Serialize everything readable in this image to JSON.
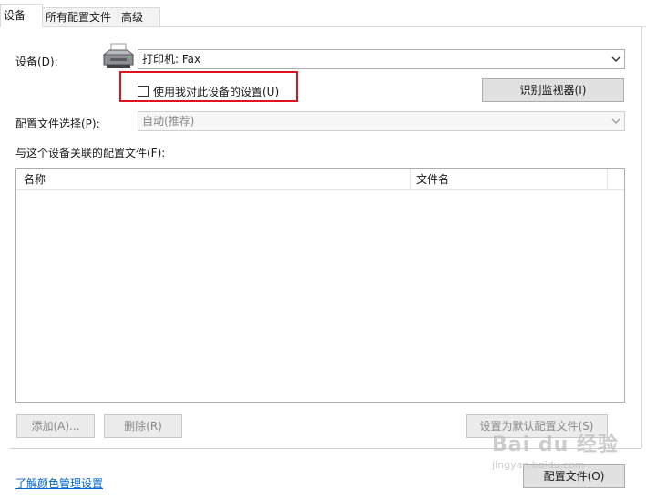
{
  "tabs": [
    {
      "label": "设备",
      "active": true
    },
    {
      "label": "所有配置文件",
      "active": false
    },
    {
      "label": "高级",
      "active": false
    }
  ],
  "device": {
    "label": "设备(D):",
    "selected": "打印机: Fax",
    "icon": "printer-icon"
  },
  "use_my_settings": {
    "label": "使用我对此设备的设置(U)",
    "checked": false
  },
  "identify_button": "识别监视器(I)",
  "profile_selection": {
    "label": "配置文件选择(P):",
    "selected": "自动(推荐)",
    "disabled": true
  },
  "associated_label": "与这个设备关联的配置文件(F):",
  "table": {
    "columns": [
      "名称",
      "文件名"
    ],
    "rows": []
  },
  "buttons": {
    "add": "添加(A)...",
    "remove": "删除(R)",
    "set_default": "设置为默认配置文件(S)",
    "profiles": "配置文件(O)"
  },
  "link": "了解颜色管理设置",
  "watermark": {
    "brand": "Bai du 经验",
    "url": "jingyan.baidu.com"
  },
  "colors": {
    "highlight_box": "#e0141e",
    "link": "#0066cc"
  }
}
